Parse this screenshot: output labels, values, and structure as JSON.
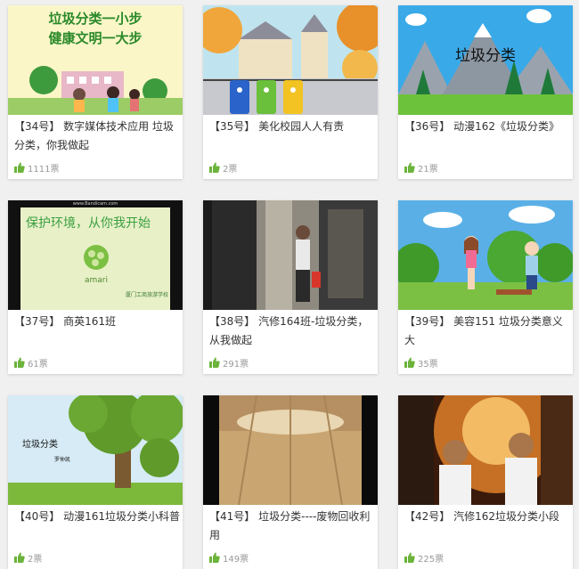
{
  "cards": [
    {
      "number": "【34号】",
      "title": "数字媒体技术应用 垃圾分类，你我做起",
      "votes": "1111票",
      "thumb_text": [
        "垃圾分类一小步",
        "健康文明一大步"
      ]
    },
    {
      "number": "【35号】",
      "title": "美化校园人人有责",
      "votes": "2票",
      "thumb_text": []
    },
    {
      "number": "【36号】",
      "title": "动漫162《垃圾分类》",
      "votes": "21票",
      "thumb_text": [
        "垃圾分类"
      ]
    },
    {
      "number": "【37号】",
      "title": "商英161班",
      "votes": "61票",
      "thumb_text": [
        "www.Bandicam.com",
        "保护环境，从你我开始",
        "amari",
        "厦门工商旅游学校"
      ]
    },
    {
      "number": "【38号】",
      "title": "汽修164班-垃圾分类，从我做起",
      "votes": "291票",
      "thumb_text": []
    },
    {
      "number": "【39号】",
      "title": "美容151 垃圾分类意义大",
      "votes": "35票",
      "thumb_text": []
    },
    {
      "number": "【40号】",
      "title": "动漫161垃圾分类小科普",
      "votes": "2票",
      "thumb_text": [
        "垃圾分类",
        "罗仲凯"
      ]
    },
    {
      "number": "【41号】",
      "title": "垃圾分类----废物回收利用",
      "votes": "149票",
      "thumb_text": []
    },
    {
      "number": "【42号】",
      "title": "汽修162垃圾分类小段",
      "votes": "225票",
      "thumb_text": []
    }
  ],
  "colors": {
    "like_icon": "#6bb33a",
    "vote_text": "#999999",
    "title_text": "#333333"
  },
  "icons": {
    "vote": "thumbs-up-icon"
  }
}
